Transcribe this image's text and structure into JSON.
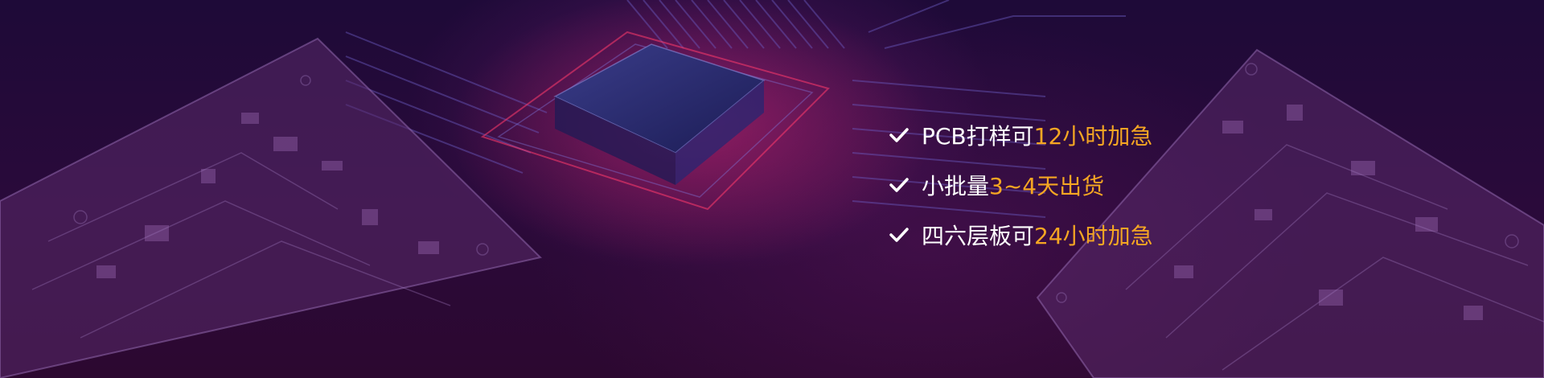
{
  "colors": {
    "text": "#ffffff",
    "highlight": "#f5a623",
    "background": "#1e0a38"
  },
  "features": [
    {
      "icon": "check-icon",
      "text": "PCB打样可",
      "highlight": "12小时加急"
    },
    {
      "icon": "check-icon",
      "text": "小批量",
      "highlight": "3~4天出货"
    },
    {
      "icon": "check-icon",
      "text": "四六层板可",
      "highlight": "24小时加急"
    }
  ]
}
